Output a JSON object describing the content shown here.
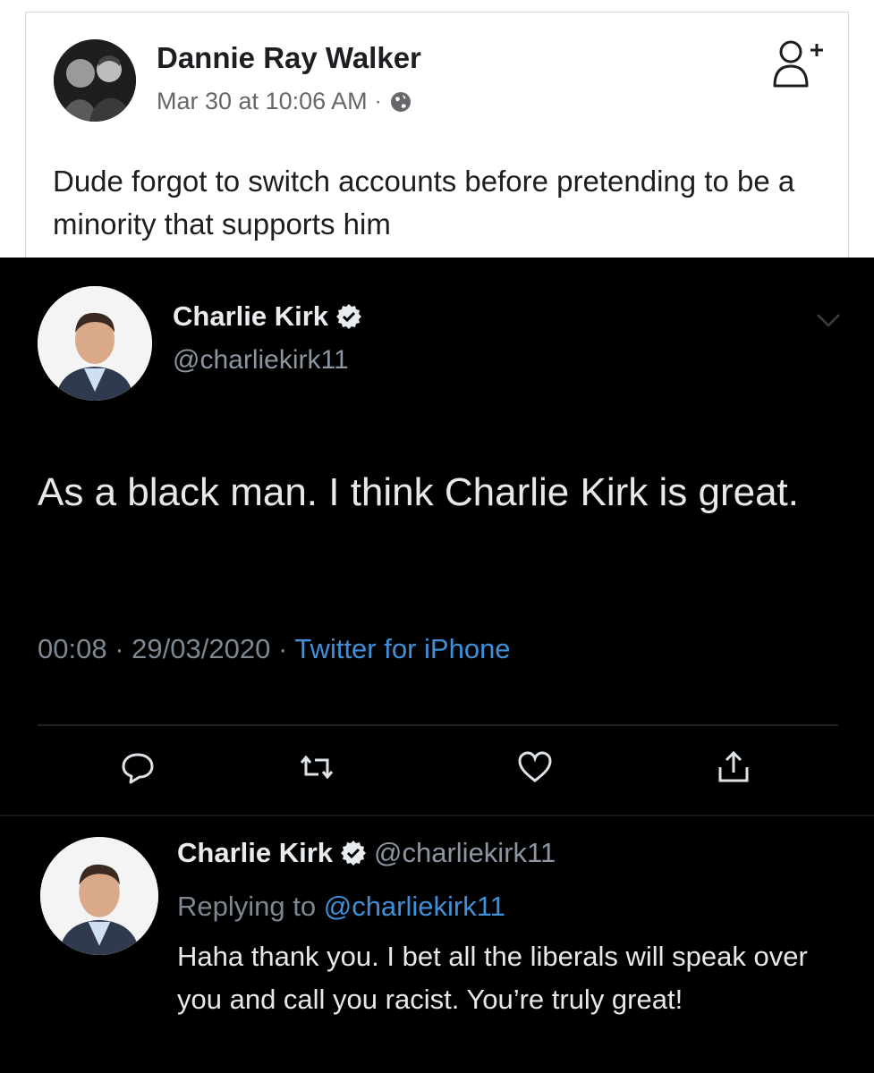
{
  "facebook_post": {
    "author": "Dannie Ray Walker",
    "timestamp": "Mar 30 at 10:06 AM",
    "separator": "·",
    "privacy_icon": "globe-icon",
    "action_icon": "add-friend-icon",
    "text": "Dude forgot to switch accounts before pretending to be a minority that supports him"
  },
  "tweet": {
    "name": "Charlie Kirk",
    "handle": "@charliekirk11",
    "text": "As a black man. I think Charlie Kirk is great.",
    "time": "00:08",
    "date": "29/03/2020",
    "source": "Twitter for iPhone",
    "sep": "·",
    "actions": [
      "reply-icon",
      "retweet-icon",
      "like-icon",
      "share-icon"
    ]
  },
  "reply": {
    "name": "Charlie Kirk",
    "handle": "@charliekirk11",
    "replying_label": "Replying to",
    "replying_to": "@charliekirk11",
    "text": "Haha thank you. I bet all the liberals will speak over you and call you racist. You’re truly great!"
  },
  "colors": {
    "twitter_bg": "#000000",
    "link_blue": "#3f90d9",
    "fb_text": "#1c1e21",
    "fb_meta": "#65676b"
  }
}
